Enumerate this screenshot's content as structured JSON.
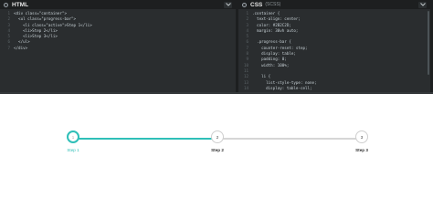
{
  "html_pane": {
    "title": "HTML",
    "lines": [
      {
        "n": "1",
        "t": "<div class=\"container\">"
      },
      {
        "n": "2",
        "t": "  <ul class=\"progress-bar\">"
      },
      {
        "n": "3",
        "t": "    <li class=\"active\">Step 1</li>"
      },
      {
        "n": "4",
        "t": "    <li>Step 2</li>"
      },
      {
        "n": "5",
        "t": "    <li>Step 3</li>"
      },
      {
        "n": "6",
        "t": "  </ul>"
      },
      {
        "n": "7",
        "t": "</div>"
      }
    ]
  },
  "css_pane": {
    "title": "CSS",
    "subtitle": "(SCSS)",
    "lines": [
      {
        "n": "1",
        "t": ".container {"
      },
      {
        "n": "2",
        "t": "  text-align: center;"
      },
      {
        "n": "3",
        "t": "  color: #2B2C2D;"
      },
      {
        "n": "4",
        "t": "  margin: 30vh auto;"
      },
      {
        "n": "5",
        "t": ""
      },
      {
        "n": "6",
        "t": "  .progress-bar {"
      },
      {
        "n": "7",
        "t": "    counter-reset: step;"
      },
      {
        "n": "8",
        "t": "    display: table;"
      },
      {
        "n": "9",
        "t": "    padding: 0;"
      },
      {
        "n": "10",
        "t": "    width: 100%;"
      },
      {
        "n": "11",
        "t": ""
      },
      {
        "n": "12",
        "t": "    li {"
      },
      {
        "n": "13",
        "t": "      list-style-type: none;"
      },
      {
        "n": "14",
        "t": "      display: table-cell;"
      }
    ]
  },
  "preview": {
    "steps": [
      {
        "number": "1",
        "label": "Step 1",
        "active": true
      },
      {
        "number": "2",
        "label": "Step 2",
        "active": false
      },
      {
        "number": "3",
        "label": "Step 3",
        "active": false
      }
    ],
    "progress": 0.5,
    "accent_color": "#2fbfb8"
  }
}
